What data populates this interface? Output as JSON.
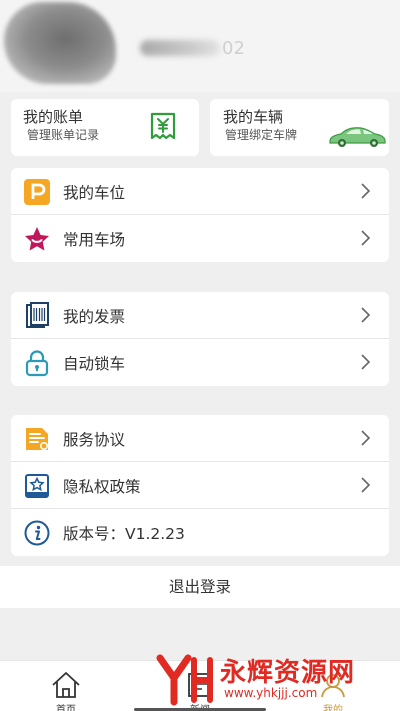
{
  "header": {
    "username_suffix": "02"
  },
  "cards": {
    "bill": {
      "title": "我的账单",
      "subtitle": "管理账单记录"
    },
    "car": {
      "title": "我的车辆",
      "subtitle": "管理绑定车牌"
    }
  },
  "menu": {
    "group1": [
      {
        "label": "我的车位",
        "icon": "parking-icon"
      },
      {
        "label": "常用车场",
        "icon": "star-icon"
      }
    ],
    "group2": [
      {
        "label": "我的发票",
        "icon": "invoice-icon"
      },
      {
        "label": "自动锁车",
        "icon": "lock-icon"
      }
    ],
    "group3": [
      {
        "label": "服务协议",
        "icon": "document-icon"
      },
      {
        "label": "隐私权政策",
        "icon": "privacy-icon"
      },
      {
        "label": "版本号：V1.2.23",
        "icon": "info-icon"
      }
    ]
  },
  "logout_label": "退出登录",
  "tabs": [
    {
      "label": "首页",
      "icon": "home-icon"
    },
    {
      "label": "新闻",
      "icon": "news-icon"
    },
    {
      "label": "我的",
      "icon": "user-icon",
      "active": true
    }
  ],
  "watermark": {
    "text": "永辉资源网",
    "url": "www.yhkjjj.com"
  },
  "colors": {
    "accent_orange": "#f5a623",
    "accent_pink": "#c2185b",
    "accent_blue": "#1e5a96",
    "bill_green": "#2e9d3a",
    "car_green": "#4caf50",
    "watermark_red": "#e02a22",
    "active_tab": "#c99a3b"
  }
}
